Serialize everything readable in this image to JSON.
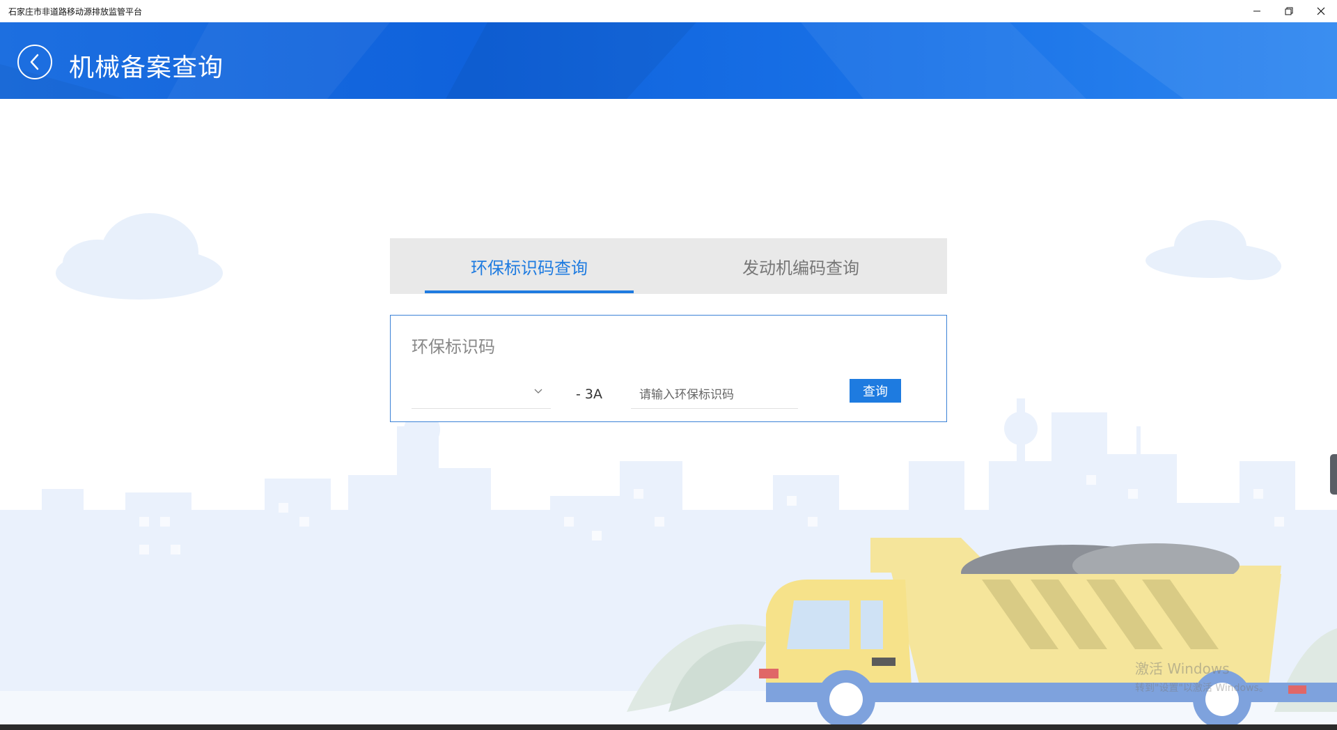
{
  "window": {
    "title": "石家庄市非道路移动源排放监管平台",
    "controls": {
      "minimize": "—",
      "restore": "❐",
      "close": "✕"
    }
  },
  "header": {
    "title": "机械备案查询",
    "back_icon": "chevron-left-icon",
    "colors": {
      "banner": "#0f62dc",
      "accent": "#1e7be0"
    }
  },
  "tabs": [
    {
      "label": "环保标识码查询",
      "active": true
    },
    {
      "label": "发动机编码查询",
      "active": false
    }
  ],
  "query": {
    "label": "环保标识码",
    "region_select": {
      "value": "",
      "icon": "chevron-down-icon"
    },
    "suffix": "- 3A",
    "input": {
      "value": "",
      "placeholder": "请输入环保标识码"
    },
    "button_label": "查询"
  },
  "watermark": {
    "line1": "激活 Windows",
    "line2": "转到\"设置\"以激活 Windows。"
  }
}
